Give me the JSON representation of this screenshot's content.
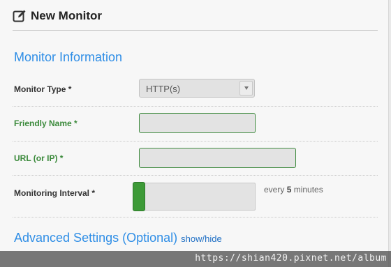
{
  "header": {
    "title": "New Monitor",
    "icon": "edit-icon"
  },
  "section_info": {
    "title": "Monitor Information"
  },
  "monitor_type": {
    "label": "Monitor Type *",
    "selected": "HTTP(s)"
  },
  "friendly_name": {
    "label": "Friendly Name *",
    "value": ""
  },
  "url": {
    "label": "URL (or IP) *",
    "value": ""
  },
  "interval": {
    "label": "Monitoring Interval *",
    "prefix": "every ",
    "value": "5",
    "suffix": " minutes",
    "slider_fraction": 0
  },
  "advanced": {
    "title": "Advanced Settings (Optional)",
    "link": "show/hide"
  },
  "watermark": "https://shian420.pixnet.net/album",
  "colors": {
    "accent": "#2f8ee6",
    "success": "#3d9a37",
    "label_green": "#3b8a3b"
  }
}
